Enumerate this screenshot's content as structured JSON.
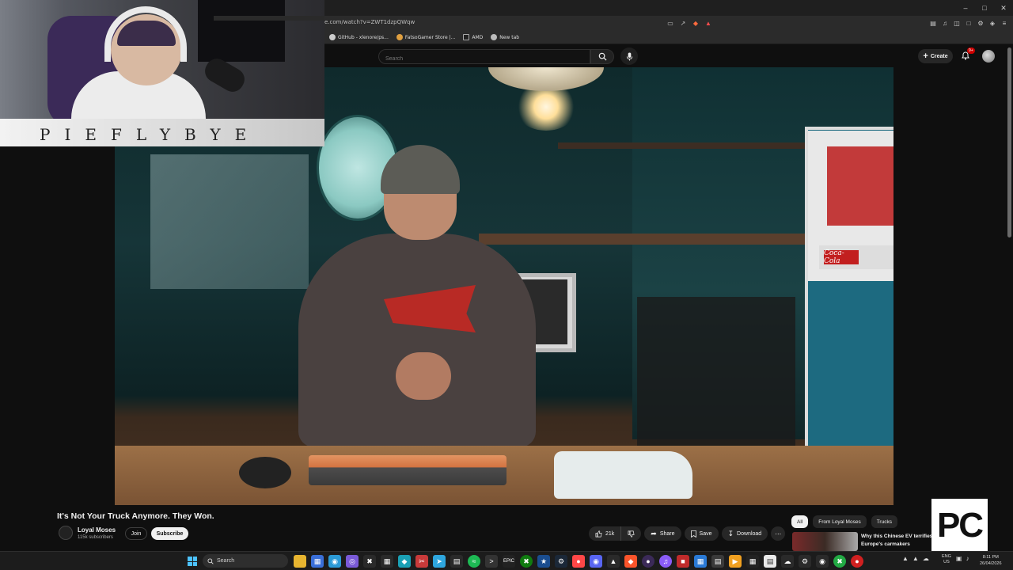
{
  "browser": {
    "url": "e.com/watch?v=ZWT1dzpQWqw",
    "bookmarks": [
      {
        "label": "GitHub - xlenore/ps..."
      },
      {
        "label": "FatsoGamer Store |..."
      },
      {
        "label": "AMD"
      },
      {
        "label": "New tab"
      }
    ]
  },
  "yt_header": {
    "search_placeholder": "Search",
    "create_label": "Create",
    "notif_badge": "9+"
  },
  "webcam": {
    "name_strip": "PIEFLYBYE"
  },
  "video": {
    "title": "It's Not Your Truck Anymore. They Won.",
    "scene_text": "Coca-Cola"
  },
  "channel": {
    "name": "Loyal Moses",
    "subscribers": "115k subscribers",
    "join_label": "Join",
    "subscribe_label": "Subscribe"
  },
  "actions": {
    "likes": "21k",
    "share_label": "Share",
    "save_label": "Save",
    "download_label": "Download"
  },
  "sidebar": {
    "chips": [
      {
        "label": "All",
        "active": true
      },
      {
        "label": "From Loyal Moses",
        "active": false
      },
      {
        "label": "Trucks",
        "active": false
      }
    ],
    "rec_title": "Why this Chinese EV terrifies Europe's carmakers"
  },
  "overlay": {
    "logo_text": "PC"
  },
  "taskbar": {
    "search_label": "Search",
    "lang_line1": "ENG",
    "lang_line2": "US",
    "time": "8:11 PM",
    "date": "26/04/2026"
  },
  "colors": {
    "accent": "#cc0000",
    "page_bg": "#0f0f0f",
    "start_icon": "#4cc2ff"
  }
}
